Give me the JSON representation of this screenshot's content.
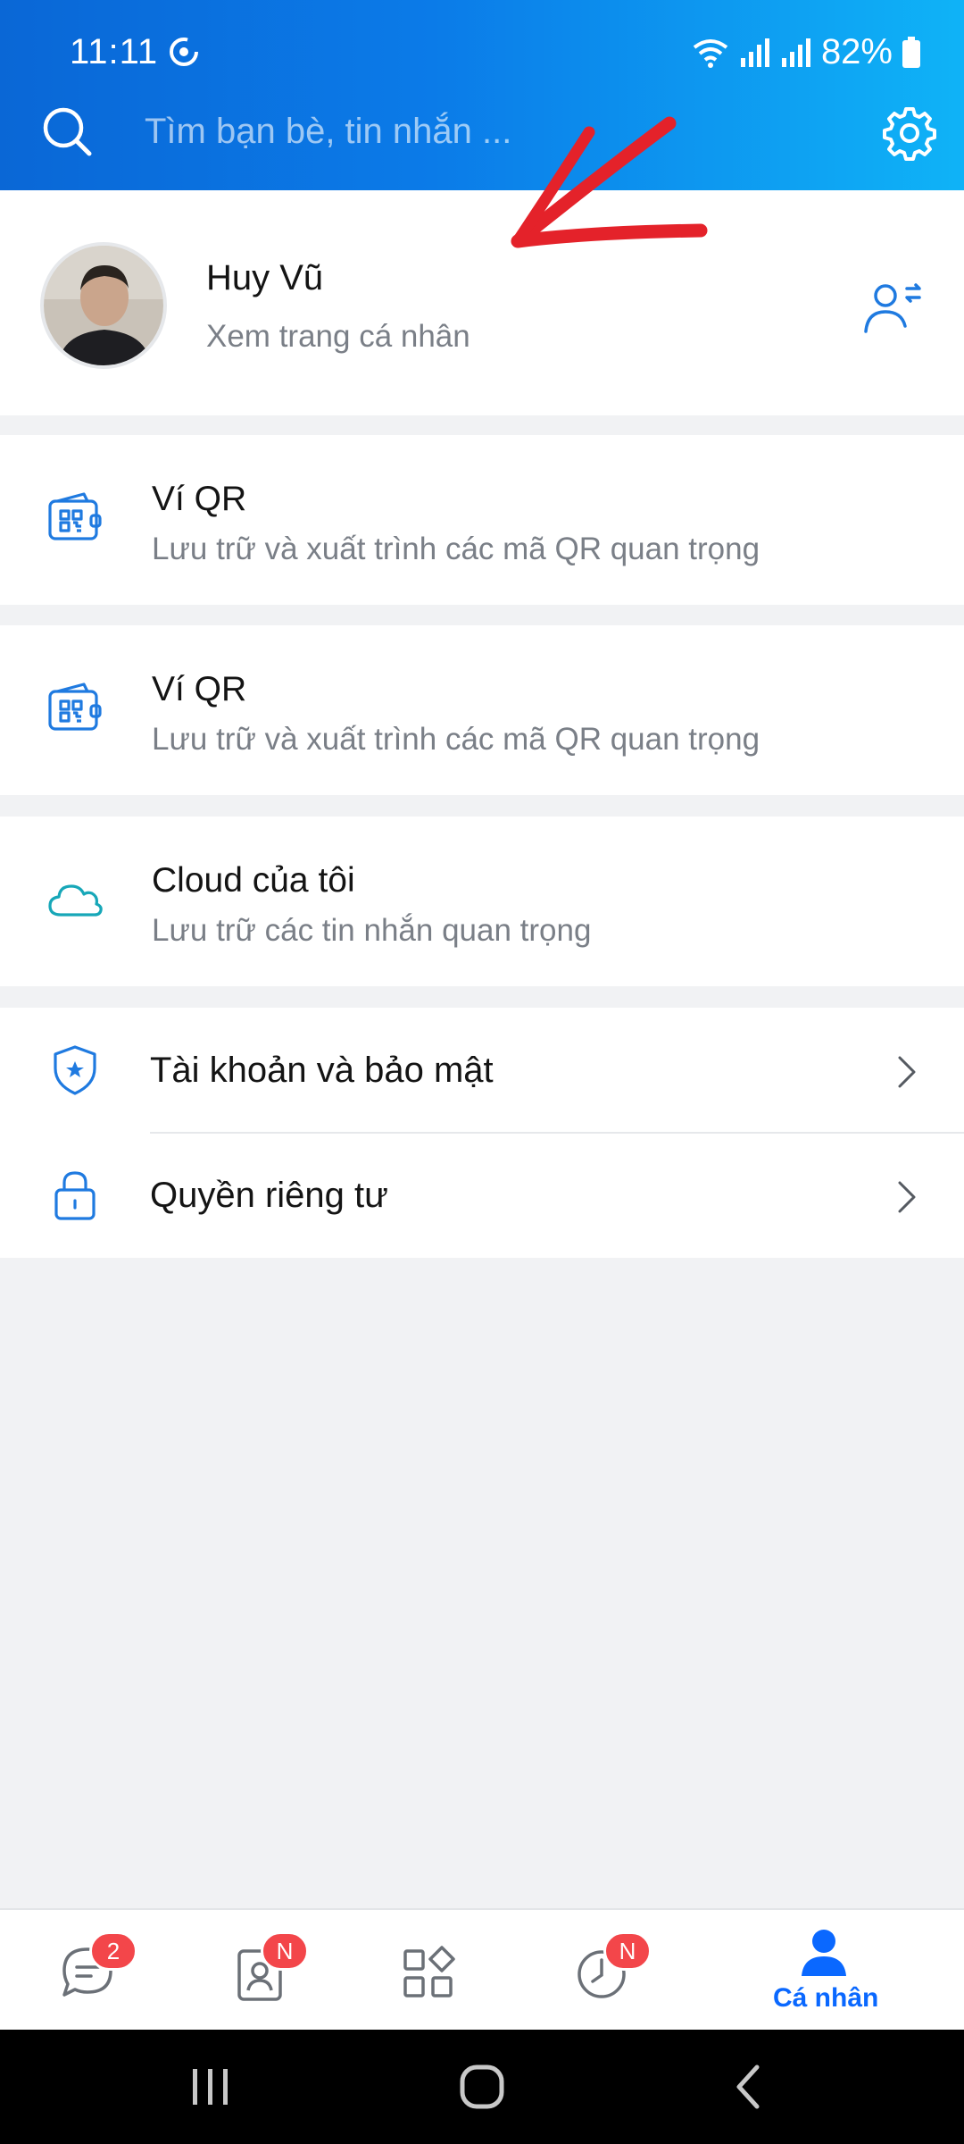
{
  "status_bar": {
    "time": "11:11",
    "battery": "82%"
  },
  "search": {
    "placeholder": "Tìm bạn bè, tin nhắn ..."
  },
  "profile": {
    "name": "Huy Vũ",
    "subtitle": "Xem trang cá nhân"
  },
  "items": [
    {
      "title": "Ví QR",
      "subtitle": "Lưu trữ và xuất trình các mã QR quan trọng",
      "icon": "qr-wallet-icon"
    },
    {
      "title": "Ví QR",
      "subtitle": "Lưu trữ và xuất trình các mã QR quan trọng",
      "icon": "qr-wallet-icon"
    },
    {
      "title": "Cloud của tôi",
      "subtitle": "Lưu trữ các tin nhắn quan trọng",
      "icon": "cloud-icon"
    }
  ],
  "settings": [
    {
      "label": "Tài khoản và bảo mật",
      "icon": "shield-icon"
    },
    {
      "label": "Quyền riêng tư",
      "icon": "lock-icon"
    }
  ],
  "bottom_nav": {
    "messages_badge": "2",
    "contacts_badge": "N",
    "timeline_badge": "N",
    "profile_label": "Cá nhân"
  },
  "colors": {
    "brand_blue": "#0a68ff",
    "badge_red": "#f3464a",
    "icon_blue": "#1f7ae0",
    "annotation_red": "#e4222a"
  }
}
